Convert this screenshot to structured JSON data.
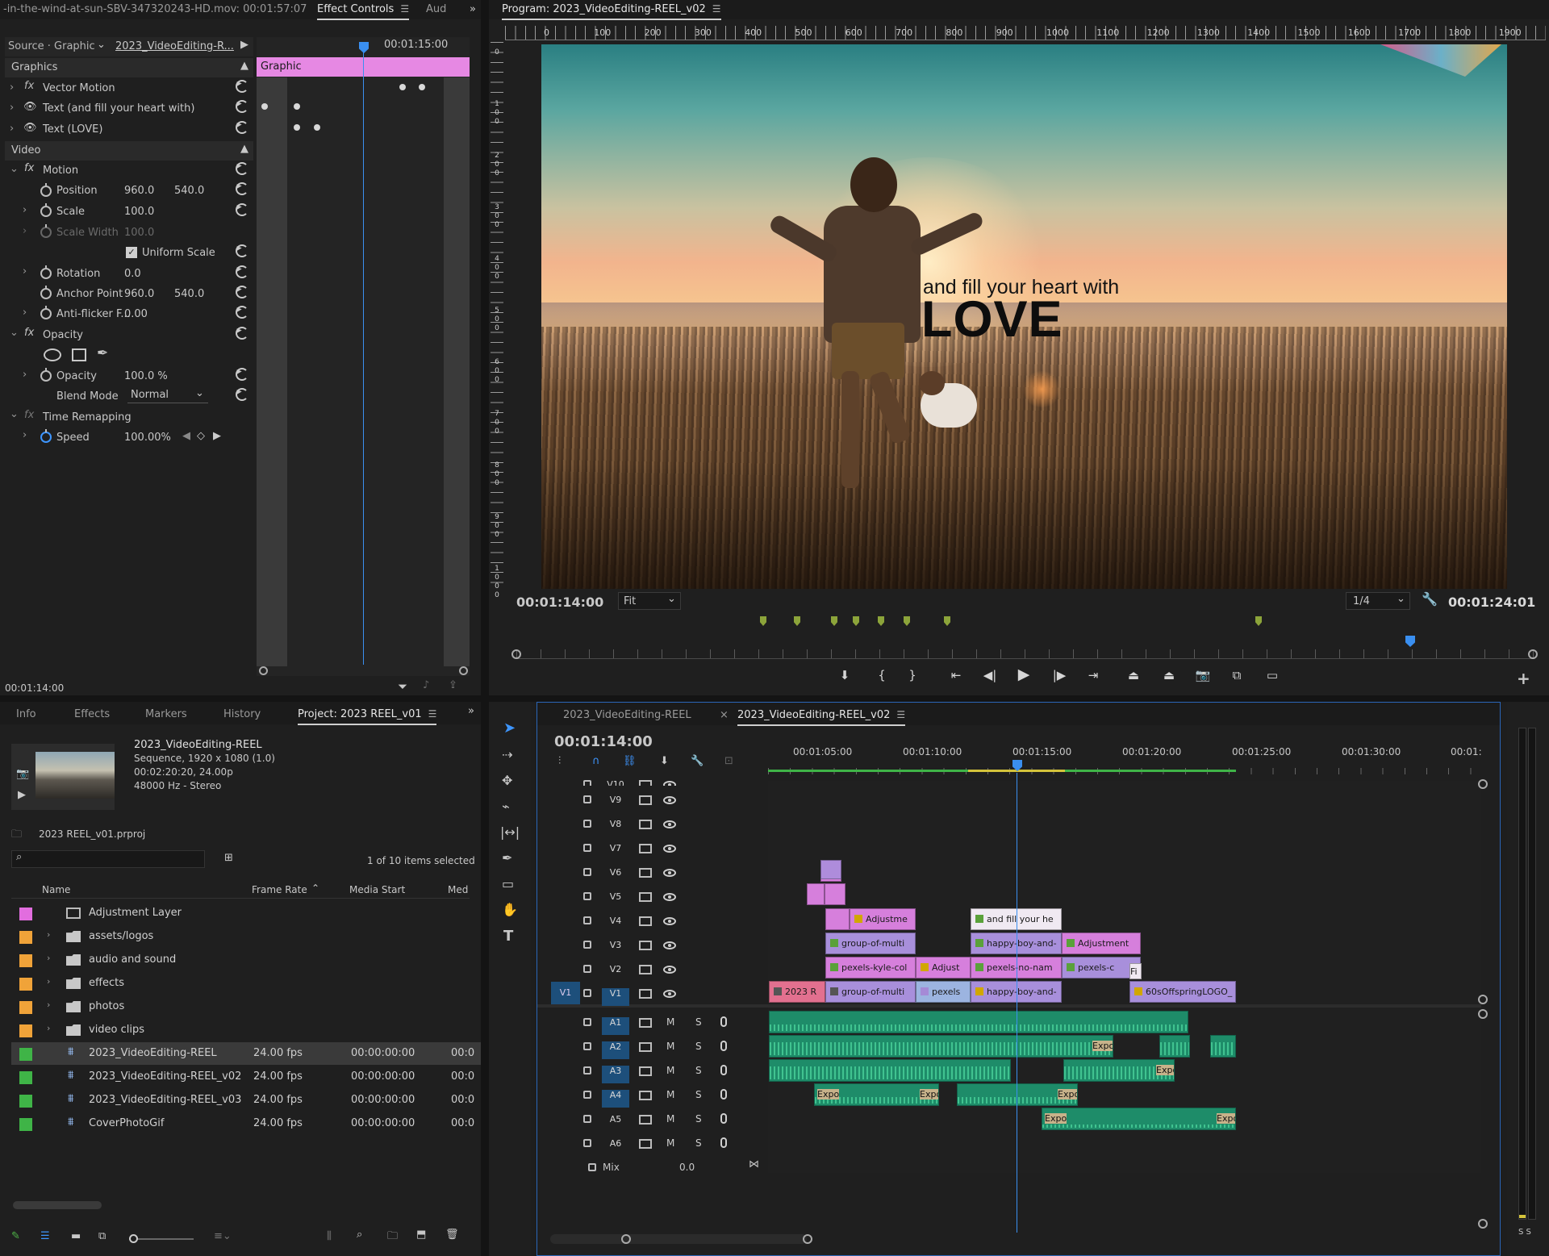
{
  "effect_controls": {
    "prev_tab": "-in-the-wind-at-sun-SBV-347320243-HD.mov: 00:01:57:07",
    "tab": "Effect Controls",
    "next_tab": "Aud",
    "source": "Source · Graphic",
    "sequence": "2023_VideoEditing-R...",
    "timecode_header": "00:01:15:00",
    "clip_label": "Graphic",
    "graphics_header": "Graphics",
    "graphics_items": [
      "Vector Motion",
      "Text (and fill your heart with)",
      "Text (LOVE)"
    ],
    "video_header": "Video",
    "motion": "Motion",
    "position_label": "Position",
    "position_x": "960.0",
    "position_y": "540.0",
    "scale_label": "Scale",
    "scale_value": "100.0",
    "scale_width_label": "Scale Width",
    "scale_width_value": "100.0",
    "uniform_scale": "Uniform Scale",
    "rotation_label": "Rotation",
    "rotation_value": "0.0",
    "anchor_label": "Anchor Point",
    "anchor_x": "960.0",
    "anchor_y": "540.0",
    "antiflicker_label": "Anti-flicker F...",
    "antiflicker_value": "0.00",
    "opacity_header": "Opacity",
    "opacity_label": "Opacity",
    "opacity_value": "100.0 %",
    "blend_label": "Blend Mode",
    "blend_value": "Normal",
    "time_remap": "Time Remapping",
    "speed_label": "Speed",
    "speed_value": "100.00%",
    "footer_timecode": "00:01:14:00"
  },
  "program": {
    "title": "Program: 2023_VideoEditing-REEL_v02",
    "ruler_ticks": [
      "0",
      "100",
      "200",
      "300",
      "400",
      "500",
      "600",
      "700",
      "800",
      "900",
      "1000",
      "1100",
      "1200",
      "1300",
      "1400",
      "1500",
      "1600",
      "1700",
      "1800",
      "1900"
    ],
    "vruler_ticks": [
      "0",
      "100",
      "200",
      "300",
      "400",
      "500",
      "600",
      "700",
      "800",
      "900",
      "1000"
    ],
    "overlay_small": "and fill your heart with",
    "overlay_big": "LOVE",
    "timecode": "00:01:14:00",
    "fit": "Fit",
    "resolution": "1/4",
    "duration": "00:01:24:01",
    "buttons": [
      "marker-icon",
      "mark-in-icon",
      "mark-out-icon",
      "go-to-in-icon",
      "step-back-icon",
      "play-icon",
      "step-forward-icon",
      "go-to-out-icon",
      "lift-icon",
      "extract-icon",
      "export-frame-icon",
      "comparison-icon",
      "proxy-icon"
    ]
  },
  "project": {
    "tabs": [
      "Info",
      "Effects",
      "Markers",
      "History",
      "Project: 2023 REEL_v01"
    ],
    "preview_name": "2023_VideoEditing-REEL",
    "preview_line1": "Sequence, 1920 x 1080 (1.0)",
    "preview_line2": "00:02:20:20, 24.00p",
    "preview_line3": "48000 Hz - Stereo",
    "file": "2023 REEL_v01.prproj",
    "selection": "1 of 10 items selected",
    "columns": [
      "Name",
      "Frame Rate",
      "Media Start",
      "Med"
    ],
    "items": [
      {
        "name": "Adjustment Layer",
        "type": "adjust",
        "color": "#e26ddf",
        "fr": "",
        "ms": "",
        "md": ""
      },
      {
        "name": "assets/logos",
        "type": "folder",
        "color": "#f0a339",
        "fr": "",
        "ms": "",
        "md": ""
      },
      {
        "name": "audio and sound",
        "type": "folder",
        "color": "#f0a339",
        "fr": "",
        "ms": "",
        "md": ""
      },
      {
        "name": "effects",
        "type": "folder",
        "color": "#f0a339",
        "fr": "",
        "ms": "",
        "md": ""
      },
      {
        "name": "photos",
        "type": "folder",
        "color": "#f0a339",
        "fr": "",
        "ms": "",
        "md": ""
      },
      {
        "name": "video clips",
        "type": "folder",
        "color": "#f0a339",
        "fr": "",
        "ms": "",
        "md": ""
      },
      {
        "name": "2023_VideoEditing-REEL",
        "type": "seq",
        "color": "#3fb447",
        "fr": "24.00 fps",
        "ms": "00:00:00:00",
        "md": "00:0"
      },
      {
        "name": "2023_VideoEditing-REEL_v02",
        "type": "seq",
        "color": "#3fb447",
        "fr": "24.00 fps",
        "ms": "00:00:00:00",
        "md": "00:0"
      },
      {
        "name": "2023_VideoEditing-REEL_v03",
        "type": "seq",
        "color": "#3fb447",
        "fr": "24.00 fps",
        "ms": "00:00:00:00",
        "md": "00:0"
      },
      {
        "name": "CoverPhotoGif",
        "type": "seq",
        "color": "#3fb447",
        "fr": "24.00 fps",
        "ms": "00:00:00:00",
        "md": "00:0"
      }
    ]
  },
  "timeline": {
    "tab1": "2023_VideoEditing-REEL",
    "tab2": "2023_VideoEditing-REEL_v02",
    "timecode": "00:01:14:00",
    "ruler": [
      "00:01:05:00",
      "00:01:10:00",
      "00:01:15:00",
      "00:01:20:00",
      "00:01:25:00",
      "00:01:30:00",
      "00:01:"
    ],
    "video_tracks": [
      "V10",
      "V9",
      "V8",
      "V7",
      "V6",
      "V5",
      "V4",
      "V3",
      "V2",
      "V1"
    ],
    "audio_tracks": [
      "A1",
      "A2",
      "A3",
      "A4",
      "A5",
      "A6"
    ],
    "v1_source": "V1",
    "mix_label": "Mix",
    "mix_value": "0.0",
    "clips": {
      "v4_a": "Adjustme",
      "v4_b": "and fill your he",
      "v3_a": "group-of-multi",
      "v3_b": "happy-boy-and-",
      "v3_c": "Adjustment",
      "v2_a": "pexels-kyle-col",
      "v2_b": "Adjust",
      "v2_c": "pexels-no-nam",
      "v2_d": "pexels-c",
      "v2_e": "Fi",
      "v1_a": "2023 R",
      "v1_b": "group-of-multi",
      "v1_c": "pexels",
      "v1_d": "happy-boy-and-",
      "v1_e": "60sOffspringLOGO_",
      "a_expo": "Expo"
    }
  },
  "meter": {
    "label": "S S"
  }
}
